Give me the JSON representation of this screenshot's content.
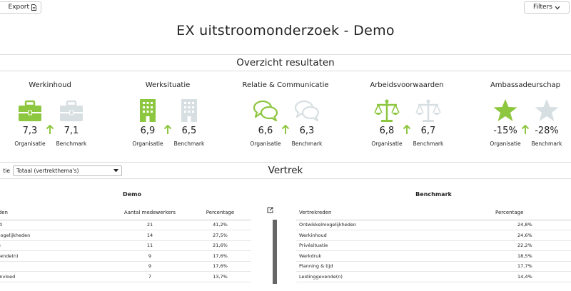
{
  "toolbar": {
    "export_label": "Export",
    "filters_label": "Filters"
  },
  "title": "EX uitstroomonderzoek - Demo",
  "overview": {
    "heading": "Overzicht resultaten",
    "org_label": "Organisatie",
    "bench_label": "Benchmark",
    "metrics": [
      {
        "title": "Werkinhoud",
        "org_value": "7,3",
        "bench_value": "7,1",
        "icon": "briefcase-icon"
      },
      {
        "title": "Werksituatie",
        "org_value": "6,9",
        "bench_value": "6,5",
        "icon": "building-icon"
      },
      {
        "title": "Relatie & Communicatie",
        "org_value": "6,6",
        "bench_value": "6,3",
        "icon": "chat-icon"
      },
      {
        "title": "Arbeidsvoorwaarden",
        "org_value": "6,8",
        "bench_value": "6,7",
        "icon": "scale-icon"
      },
      {
        "title": "Ambassadeurschap",
        "org_value": "-15%",
        "bench_value": "-28%",
        "icon": "star-icon"
      }
    ]
  },
  "colors": {
    "accent": "#8dc63f",
    "muted": "#d7dfe2",
    "arrow": "#8dc63f"
  },
  "vertrek": {
    "heading": "Vertrek",
    "select_prefix": "tie",
    "select_value": "Totaal (vertrekthema's)"
  },
  "demo_table": {
    "title": "Demo",
    "headers": [
      "rtrekreden",
      "Aantal medewerkers",
      "Percentage"
    ],
    "rows": [
      [
        "rkinhoud",
        "21",
        "41,2%"
      ],
      [
        "wikkelmogelijkheden",
        "14",
        "27,5%"
      ],
      [
        "rsituatie",
        "11",
        "21,6%"
      ],
      [
        "dinggevende(n)",
        "9",
        "17,6%"
      ],
      [
        "kdruk",
        "9",
        "17,6%"
      ],
      [
        "raak & invloed",
        "7",
        "13,7%"
      ]
    ]
  },
  "bench_table": {
    "title": "Benchmark",
    "headers": [
      "Vertrekreden",
      "Percentage"
    ],
    "rows": [
      [
        "Ontwikkelmogelijkheden",
        "24,8%"
      ],
      [
        "Werkinhoud",
        "24,6%"
      ],
      [
        "Privésituatie",
        "22,2%"
      ],
      [
        "Werkdruk",
        "18,5%"
      ],
      [
        "Planning & tijd",
        "17,7%"
      ],
      [
        "Leidinggevende(n)",
        "14,4%"
      ]
    ]
  }
}
